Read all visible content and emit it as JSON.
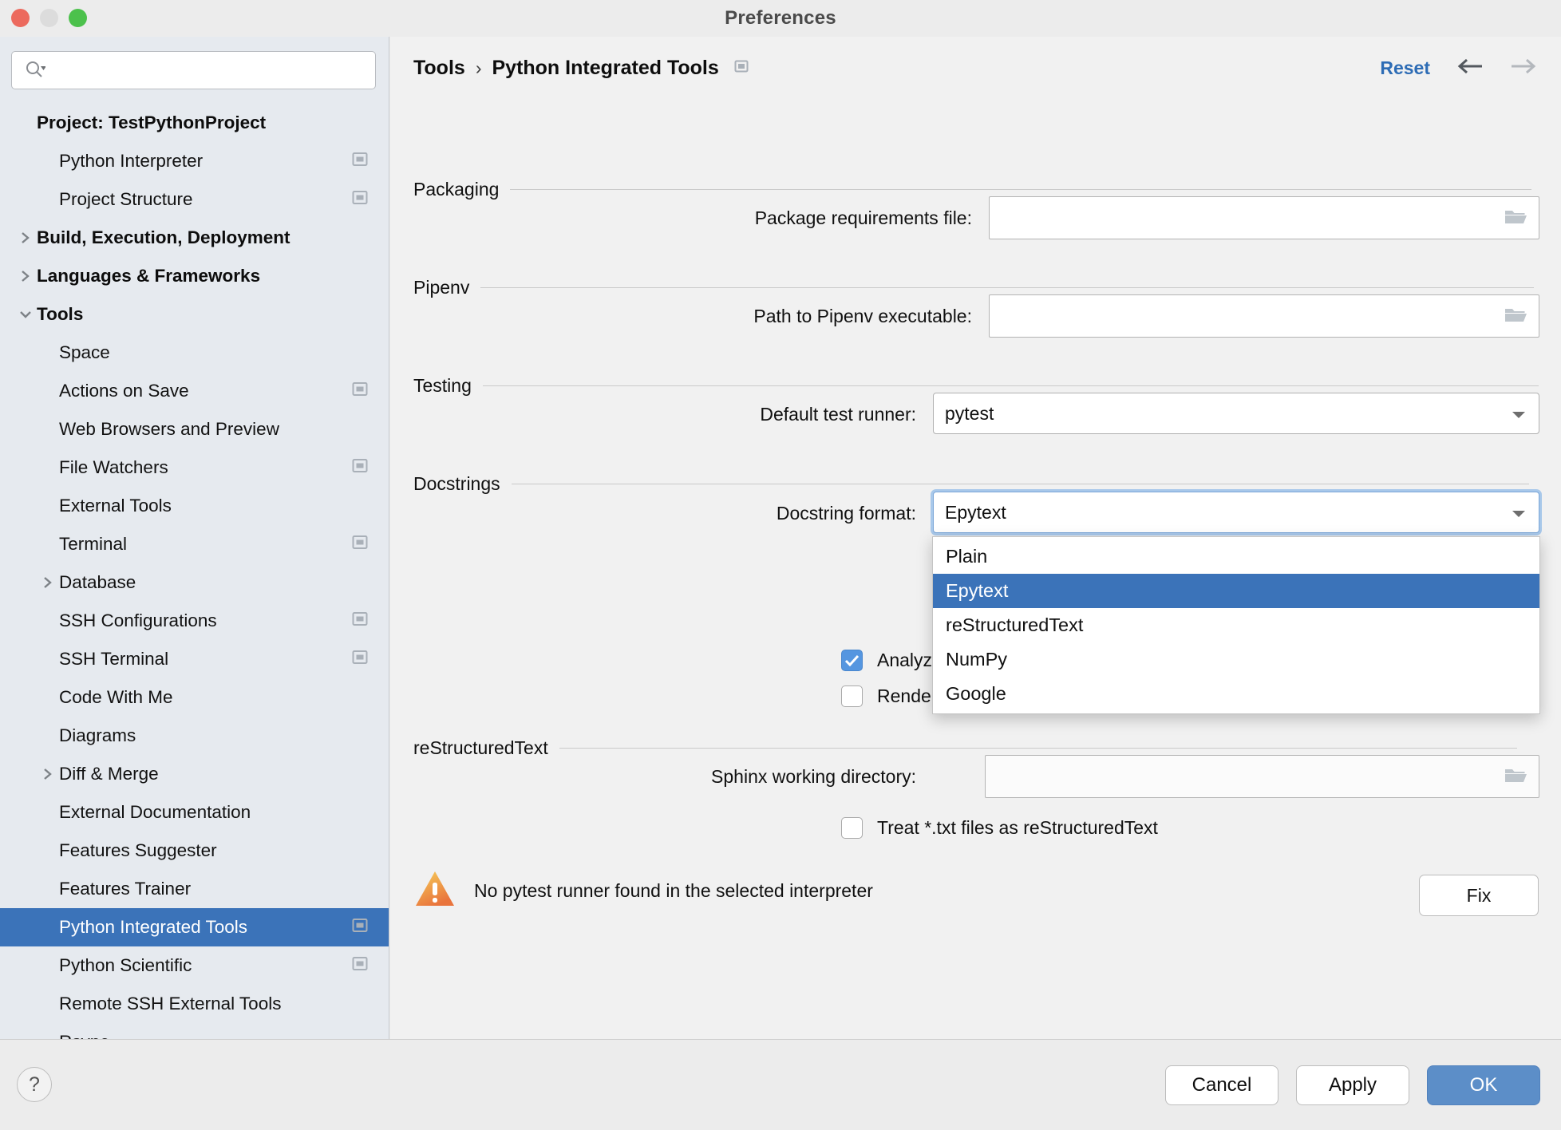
{
  "window": {
    "title": "Preferences",
    "traffic_lights": [
      "close",
      "minimize",
      "maximize"
    ]
  },
  "sidebar": {
    "search": {
      "value": "",
      "placeholder": ""
    },
    "items": [
      {
        "label": "Project: TestPythonProject",
        "level": 0,
        "bold": true,
        "twisty": "none",
        "badge": false,
        "selected": false
      },
      {
        "label": "Python Interpreter",
        "level": 1,
        "bold": false,
        "twisty": "none",
        "badge": true,
        "selected": false
      },
      {
        "label": "Project Structure",
        "level": 1,
        "bold": false,
        "twisty": "none",
        "badge": true,
        "selected": false
      },
      {
        "label": "Build, Execution, Deployment",
        "level": 0,
        "bold": true,
        "twisty": "collapsed",
        "badge": false,
        "selected": false
      },
      {
        "label": "Languages & Frameworks",
        "level": 0,
        "bold": true,
        "twisty": "collapsed",
        "badge": false,
        "selected": false
      },
      {
        "label": "Tools",
        "level": 0,
        "bold": true,
        "twisty": "expanded",
        "badge": false,
        "selected": false
      },
      {
        "label": "Space",
        "level": 1,
        "bold": false,
        "twisty": "none",
        "badge": false,
        "selected": false
      },
      {
        "label": "Actions on Save",
        "level": 1,
        "bold": false,
        "twisty": "none",
        "badge": true,
        "selected": false
      },
      {
        "label": "Web Browsers and Preview",
        "level": 1,
        "bold": false,
        "twisty": "none",
        "badge": false,
        "selected": false
      },
      {
        "label": "File Watchers",
        "level": 1,
        "bold": false,
        "twisty": "none",
        "badge": true,
        "selected": false
      },
      {
        "label": "External Tools",
        "level": 1,
        "bold": false,
        "twisty": "none",
        "badge": false,
        "selected": false
      },
      {
        "label": "Terminal",
        "level": 1,
        "bold": false,
        "twisty": "none",
        "badge": true,
        "selected": false
      },
      {
        "label": "Database",
        "level": 1,
        "bold": false,
        "twisty": "collapsed",
        "badge": false,
        "selected": false
      },
      {
        "label": "SSH Configurations",
        "level": 1,
        "bold": false,
        "twisty": "none",
        "badge": true,
        "selected": false
      },
      {
        "label": "SSH Terminal",
        "level": 1,
        "bold": false,
        "twisty": "none",
        "badge": true,
        "selected": false
      },
      {
        "label": "Code With Me",
        "level": 1,
        "bold": false,
        "twisty": "none",
        "badge": false,
        "selected": false
      },
      {
        "label": "Diagrams",
        "level": 1,
        "bold": false,
        "twisty": "none",
        "badge": false,
        "selected": false
      },
      {
        "label": "Diff & Merge",
        "level": 1,
        "bold": false,
        "twisty": "collapsed",
        "badge": false,
        "selected": false
      },
      {
        "label": "External Documentation",
        "level": 1,
        "bold": false,
        "twisty": "none",
        "badge": false,
        "selected": false
      },
      {
        "label": "Features Suggester",
        "level": 1,
        "bold": false,
        "twisty": "none",
        "badge": false,
        "selected": false
      },
      {
        "label": "Features Trainer",
        "level": 1,
        "bold": false,
        "twisty": "none",
        "badge": false,
        "selected": false
      },
      {
        "label": "Python Integrated Tools",
        "level": 1,
        "bold": false,
        "twisty": "none",
        "badge": true,
        "selected": true
      },
      {
        "label": "Python Scientific",
        "level": 1,
        "bold": false,
        "twisty": "none",
        "badge": true,
        "selected": false
      },
      {
        "label": "Remote SSH External Tools",
        "level": 1,
        "bold": false,
        "twisty": "none",
        "badge": false,
        "selected": false
      },
      {
        "label": "Rsync",
        "level": 1,
        "bold": false,
        "twisty": "none",
        "badge": false,
        "selected": false
      }
    ]
  },
  "header": {
    "breadcrumb": [
      "Tools",
      "Python Integrated Tools"
    ],
    "separator": "›",
    "reset_label": "Reset",
    "back_icon": "arrow-left-icon",
    "forward_icon": "arrow-right-icon"
  },
  "main": {
    "packaging": {
      "section_title": "Packaging",
      "requirements_label": "Package requirements file:",
      "requirements_value": "",
      "browse_icon": "folder-icon"
    },
    "pipenv": {
      "section_title": "Pipenv",
      "path_label": "Path to Pipenv executable:",
      "path_value": "",
      "browse_icon": "folder-icon"
    },
    "testing": {
      "section_title": "Testing",
      "runner_label": "Default test runner:",
      "runner_value": "pytest"
    },
    "docstrings": {
      "section_title": "Docstrings",
      "format_label": "Docstring format:",
      "format_value": "Epytext",
      "format_options": [
        "Plain",
        "Epytext",
        "reStructuredText",
        "NumPy",
        "Google"
      ],
      "dropdown_open": true,
      "analyze_label": "Analyze Python code in docstrings",
      "analyze_checked": true,
      "render_label": "Render external documentation for stdlib",
      "render_checked": false
    },
    "restructuredtext": {
      "section_title": "reStructuredText",
      "sphinx_label": "Sphinx working directory:",
      "sphinx_value": "",
      "browse_icon": "folder-icon",
      "treat_txt_label": "Treat *.txt files as reStructuredText",
      "treat_txt_checked": false
    },
    "warning": {
      "icon": "warning-triangle-icon",
      "text": "No pytest runner found in the selected interpreter",
      "fix_label": "Fix"
    }
  },
  "footer": {
    "help_label": "?",
    "cancel_label": "Cancel",
    "apply_label": "Apply",
    "ok_label": "OK"
  },
  "colors": {
    "accent_selection": "#3b73b9",
    "primary_button": "#5c8ec8",
    "link": "#2d6cb5",
    "sidebar_bg": "#e6eaef",
    "panel_bg": "#f1f1f1"
  }
}
